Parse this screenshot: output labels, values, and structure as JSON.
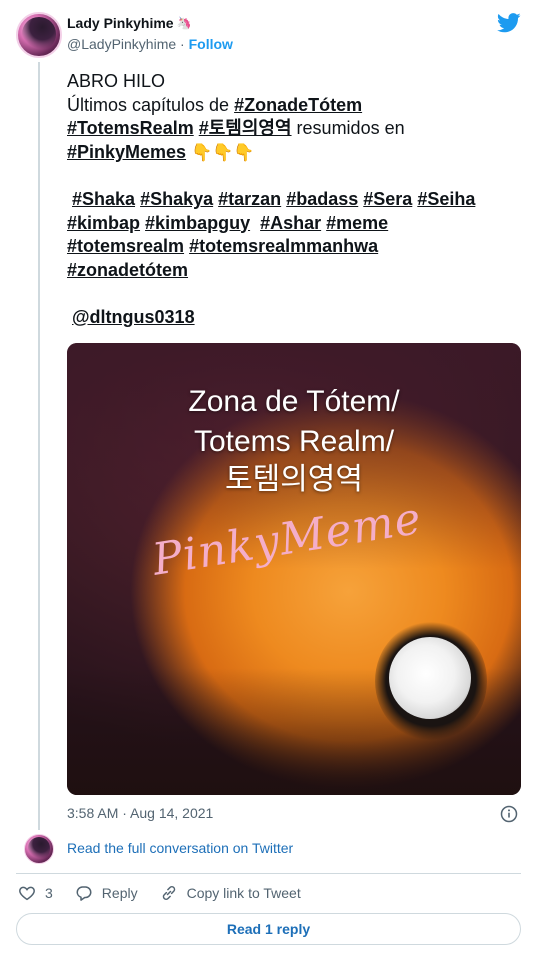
{
  "author": {
    "name": "Lady Pinkyhime",
    "name_emoji": "🦄",
    "handle": "@LadyPinkyhime",
    "separator": "·",
    "follow_label": "Follow"
  },
  "tweet": {
    "line1": "ABRO HILO",
    "line2_prefix": "Últimos capítulos de ",
    "tag_zonadetotem": "#ZonadeTótem",
    "tag_totemsrealm": "#TotemsRealm",
    "tag_korean": "#토템의영역",
    "line3_suffix": " resumidos en",
    "tag_pinkymemes": "#PinkyMemes",
    "emojis": "👇👇👇",
    "tag_shaka": "#Shaka",
    "tag_shakya": "#Shakya",
    "tag_tarzan": "#tarzan",
    "tag_badass": "#badass",
    "tag_sera": "#Sera",
    "tag_seiha": "#Seiha",
    "tag_kimbap": "#kimbap",
    "tag_kimbapguy": "#kimbapguy",
    "tag_ashar": "#Ashar",
    "tag_meme": "#meme",
    "tag_totemsrealm_lower": "#totemsrealm",
    "tag_totemsrealmmanhwa": "#totemsrealmmanhwa",
    "tag_zonadetotem_lower": "#zonadetótem",
    "mention": "@dltngus0318"
  },
  "media": {
    "caption_line1": "Zona de Tótem/",
    "caption_line2": "Totems Realm/",
    "caption_line3": "토템의영역",
    "watermark": "PinkyMeme"
  },
  "timestamp": "3:58 AM · Aug 14, 2021",
  "read_full_conversation": "Read the full conversation on Twitter",
  "actions": {
    "like_count": "3",
    "reply_label": "Reply",
    "copy_link_label": "Copy link to Tweet"
  },
  "read_reply_label": "Read 1 reply",
  "colors": {
    "twitter_blue": "#1d9bf0",
    "link_blue": "#1d6fb8",
    "text": "#0f1419",
    "secondary": "#536471"
  }
}
